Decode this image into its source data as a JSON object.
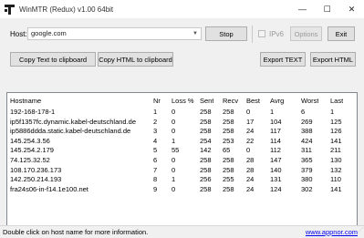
{
  "window": {
    "title": "WinMTR (Redux) v1.00 64bit",
    "minimize_glyph": "—",
    "maximize_glyph": "☐",
    "close_glyph": "✕"
  },
  "toolbar": {
    "host_label": "Host:",
    "host_value": "google.com",
    "stop_label": "Stop",
    "ipv6_label": "IPv6",
    "options_label": "Options",
    "exit_label": "Exit",
    "copy_text_label": "Copy Text to clipboard",
    "copy_html_label": "Copy HTML to clipboard",
    "export_text_label": "Export TEXT",
    "export_html_label": "Export HTML"
  },
  "table": {
    "columns": [
      "Hostname",
      "Nr",
      "Loss %",
      "Sent",
      "Recv",
      "Best",
      "Avrg",
      "Worst",
      "Last"
    ],
    "rows": [
      [
        "192-168-178-1",
        "1",
        "0",
        "258",
        "258",
        "0",
        "1",
        "6",
        "1"
      ],
      [
        "ip5f1357fc.dynamic.kabel-deutschland.de",
        "2",
        "0",
        "258",
        "258",
        "17",
        "104",
        "269",
        "125"
      ],
      [
        "ip5886ddda.static.kabel-deutschland.de",
        "3",
        "0",
        "258",
        "258",
        "24",
        "117",
        "388",
        "126"
      ],
      [
        "145.254.3.56",
        "4",
        "1",
        "254",
        "253",
        "22",
        "114",
        "424",
        "141"
      ],
      [
        "145.254.2.179",
        "5",
        "55",
        "142",
        "65",
        "0",
        "112",
        "311",
        "211"
      ],
      [
        "74.125.32.52",
        "6",
        "0",
        "258",
        "258",
        "28",
        "147",
        "365",
        "130"
      ],
      [
        "108.170.236.173",
        "7",
        "0",
        "258",
        "258",
        "28",
        "140",
        "379",
        "132"
      ],
      [
        "142.250.214.193",
        "8",
        "1",
        "256",
        "255",
        "24",
        "131",
        "380",
        "110"
      ],
      [
        "fra24s06-in-f14.1e100.net",
        "9",
        "0",
        "258",
        "258",
        "24",
        "124",
        "302",
        "141"
      ]
    ]
  },
  "status": {
    "text": "Double click on host name for more information.",
    "link": "www.appnor.com"
  }
}
